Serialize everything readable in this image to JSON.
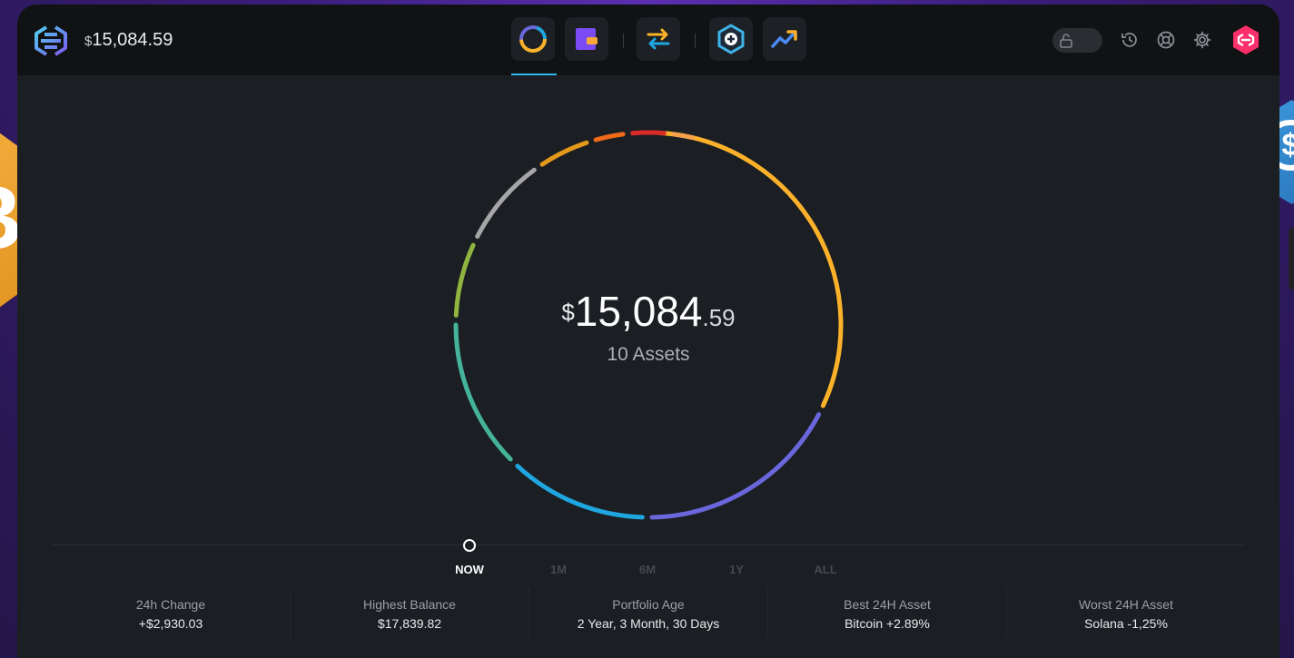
{
  "header": {
    "balance_currency": "$",
    "balance_value": "15,084.59",
    "nav": [
      {
        "name": "portfolio",
        "icon": "donut-chart-icon",
        "active": true
      },
      {
        "name": "wallet",
        "icon": "wallet-icon",
        "active": false
      },
      {
        "name": "exchange",
        "icon": "exchange-arrows-icon",
        "active": false
      },
      {
        "name": "add-apps",
        "icon": "plus-hex-icon",
        "active": false
      },
      {
        "name": "trading",
        "icon": "trend-up-icon",
        "active": false
      }
    ],
    "right_icons": [
      "lock-icon",
      "history-icon",
      "support-icon",
      "settings-icon",
      "profile-avatar-icon"
    ]
  },
  "portfolio": {
    "currency": "$",
    "amount_int": "15,084",
    "amount_dec": ".59",
    "assets_label": "10 Assets",
    "segments": [
      {
        "color": "#fbb22a",
        "share": 0.318
      },
      {
        "color": "#6a66dc",
        "share": 0.178
      },
      {
        "color": "#1fa6e0",
        "share": 0.122
      },
      {
        "color": "#44b39a",
        "share": 0.131
      },
      {
        "color": "#8fb43f",
        "share": 0.068
      },
      {
        "color": "#a6a6a6",
        "share": 0.081
      },
      {
        "color": "#e39a1c",
        "share": 0.049
      },
      {
        "color": "#f06a1a",
        "share": 0.031
      },
      {
        "color": "#d92a28",
        "share": 0.034
      },
      {
        "color": "#f4a14a",
        "share": 0.024
      }
    ]
  },
  "timeline": {
    "ranges": [
      "NOW",
      "1M",
      "6M",
      "1Y",
      "ALL"
    ],
    "active": "NOW"
  },
  "stats": [
    {
      "label": "24h Change",
      "value": "+$2,930.03"
    },
    {
      "label": "Highest Balance",
      "value": "$17,839.82"
    },
    {
      "label": "Portfolio Age",
      "value": "2 Year, 3 Month, 30 Days"
    },
    {
      "label": "Best 24H Asset",
      "value": "Bitcoin +2.89%"
    },
    {
      "label": "Worst 24H Asset",
      "value": "Solana -1,25%"
    }
  ],
  "colors": {
    "accent": "#2fb6f0",
    "brand": "#fb2f6a"
  }
}
